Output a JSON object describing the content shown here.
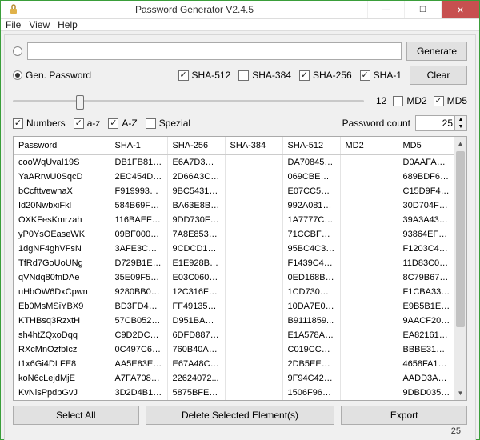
{
  "window": {
    "title": "Password Generator V2.4.5"
  },
  "menu": {
    "file": "File",
    "view": "View",
    "help": "Help"
  },
  "buttons": {
    "generate": "Generate",
    "clear": "Clear",
    "selectAll": "Select All",
    "deleteSel": "Delete Selected Element(s)",
    "export": "Export"
  },
  "labels": {
    "genPassword": "Gen. Password",
    "sha512": "SHA-512",
    "sha384": "SHA-384",
    "sha256": "SHA-256",
    "sha1": "SHA-1",
    "md2": "MD2",
    "md5": "MD5",
    "numbers": "Numbers",
    "az": "a-z",
    "AZ": "A-Z",
    "spezial": "Spezial",
    "pwCount": "Password count"
  },
  "slider": {
    "value": "12",
    "thumbPercent": 18
  },
  "countValue": "25",
  "checks": {
    "sha512": true,
    "sha384": false,
    "sha256": true,
    "sha1": true,
    "md2": false,
    "md5": true,
    "numbers": true,
    "az": true,
    "AZ": true,
    "spezial": false
  },
  "table": {
    "headers": {
      "password": "Password",
      "sha1": "SHA-1",
      "sha256": "SHA-256",
      "sha384": "SHA-384",
      "sha512": "SHA-512",
      "md2": "MD2",
      "md5": "MD5"
    },
    "rows": [
      {
        "p": "cooWqUvaI19S",
        "s1": "DB1FB814...",
        "s256": "E6A7D3A5...",
        "s384": "",
        "s512": "DA70845D...",
        "m2": "",
        "m5": "D0AAFA33..."
      },
      {
        "p": "YaARrwU0SqcD",
        "s1": "2EC454D2...",
        "s256": "2D66A3C7...",
        "s384": "",
        "s512": "069CBED4...",
        "m2": "",
        "m5": "689BDF69..."
      },
      {
        "p": "bCcfttvewhaX",
        "s1": "F919993B...",
        "s256": "9BC5431F...",
        "s384": "",
        "s512": "E07CC5B6...",
        "m2": "",
        "m5": "C15D9F48..."
      },
      {
        "p": "Id20NwbxiFkl",
        "s1": "584B69FF...",
        "s256": "BA63E8B5...",
        "s384": "",
        "s512": "992A0818...",
        "m2": "",
        "m5": "30D704F2..."
      },
      {
        "p": "OXKFesKmrzah",
        "s1": "116BAEFD...",
        "s256": "9DD730F9...",
        "s384": "",
        "s512": "1A7777CC...",
        "m2": "",
        "m5": "39A3A43A..."
      },
      {
        "p": "yP0YsOEaseWK",
        "s1": "09BF000D...",
        "s256": "7A8E8532...",
        "s384": "",
        "s512": "71CCBF51...",
        "m2": "",
        "m5": "93864EF3..."
      },
      {
        "p": "1dgNF4ghVFsN",
        "s1": "3AFE3CFB...",
        "s256": "9CDCD184...",
        "s384": "",
        "s512": "95BC4C3D...",
        "m2": "",
        "m5": "F1203C41..."
      },
      {
        "p": "TfRd7GoUoUNg",
        "s1": "D729B1EC...",
        "s256": "E1E928B5...",
        "s384": "",
        "s512": "F1439C4E...",
        "m2": "",
        "m5": "11D83C0E..."
      },
      {
        "p": "qVNdq80fnDAe",
        "s1": "35E09F57...",
        "s256": "E03C0600...",
        "s384": "",
        "s512": "0ED168B9...",
        "m2": "",
        "m5": "8C79B672..."
      },
      {
        "p": "uHbOW6DxCpwn",
        "s1": "9280BB03...",
        "s256": "12C316FB...",
        "s384": "",
        "s512": "1CD730CB...",
        "m2": "",
        "m5": "F1CBA33B..."
      },
      {
        "p": "Eb0MsMSiYBX9",
        "s1": "BD3FD44B...",
        "s256": "FF491355...",
        "s384": "",
        "s512": "10DA7E0F...",
        "m2": "",
        "m5": "E9B5B1E7..."
      },
      {
        "p": "KTHBsq3RzxtH",
        "s1": "57CB052A...",
        "s256": "D951BAEE...",
        "s384": "",
        "s512": "B9111859...",
        "m2": "",
        "m5": "9AACF209..."
      },
      {
        "p": "sh4htZQxoDqq",
        "s1": "C9D2DC66...",
        "s256": "6DFD8877...",
        "s384": "",
        "s512": "E1A578AC...",
        "m2": "",
        "m5": "EA82161B..."
      },
      {
        "p": "RXcMnOzfbIcz",
        "s1": "0C497C63...",
        "s256": "760B40AC...",
        "s384": "",
        "s512": "C019CCCC...",
        "m2": "",
        "m5": "BBBE31AC..."
      },
      {
        "p": "t1x6Gi4DLFE8",
        "s1": "AA5E83EB...",
        "s256": "E67A48C6...",
        "s384": "",
        "s512": "2DB5EEEE...",
        "m2": "",
        "m5": "4658FA1E..."
      },
      {
        "p": "koN6cLejdMjE",
        "s1": "A7FA7087...",
        "s256": "22624072...",
        "s384": "",
        "s512": "9F94C42B...",
        "m2": "",
        "m5": "AADD3A93..."
      },
      {
        "p": "KvNlsPpdpGvJ",
        "s1": "3D2D4B1C...",
        "s256": "5875BFE5...",
        "s384": "",
        "s512": "1506F96C...",
        "m2": "",
        "m5": "9DBD0356..."
      }
    ]
  },
  "status": "25"
}
